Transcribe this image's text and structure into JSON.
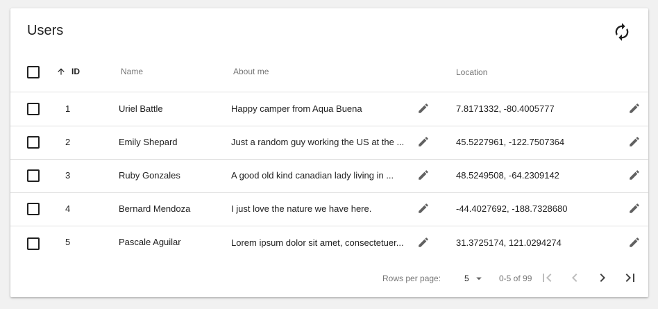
{
  "header": {
    "title": "Users",
    "refresh_icon": "refresh-icon"
  },
  "columns": {
    "id": "ID",
    "name": "Name",
    "about": "About me",
    "location": "Location",
    "sort": {
      "column": "ID",
      "direction": "ascending"
    }
  },
  "rows": [
    {
      "id": "1",
      "name": "Uriel Battle",
      "about": "Happy camper from Aqua Buena",
      "location": "7.8171332, -80.4005777"
    },
    {
      "id": "2",
      "name": "Emily Shepard",
      "about": "Just a random guy working the US at the ...",
      "location": "45.5227961, -122.7507364"
    },
    {
      "id": "3",
      "name": "Ruby Gonzales",
      "about": "A good old kind canadian lady living in ...",
      "location": "48.5249508, -64.2309142"
    },
    {
      "id": "4",
      "name": "Bernard Mendoza",
      "about": "I just love the nature we have here.",
      "location": "-44.4027692, -188.7328680"
    },
    {
      "id": "5",
      "name": "Pascale Aguilar",
      "about": "Lorem ipsum dolor sit amet, consectetuer...",
      "location": "31.3725174, 121.0294274"
    }
  ],
  "footer": {
    "rows_per_page_label": "Rows per page:",
    "rows_per_page_value": "5",
    "range": "0-5 of 99"
  },
  "colors": {
    "text": "#212121",
    "muted": "#757575",
    "divider": "#e0e0e0",
    "icon": "#616161",
    "disabled": "#bdbdbd"
  }
}
